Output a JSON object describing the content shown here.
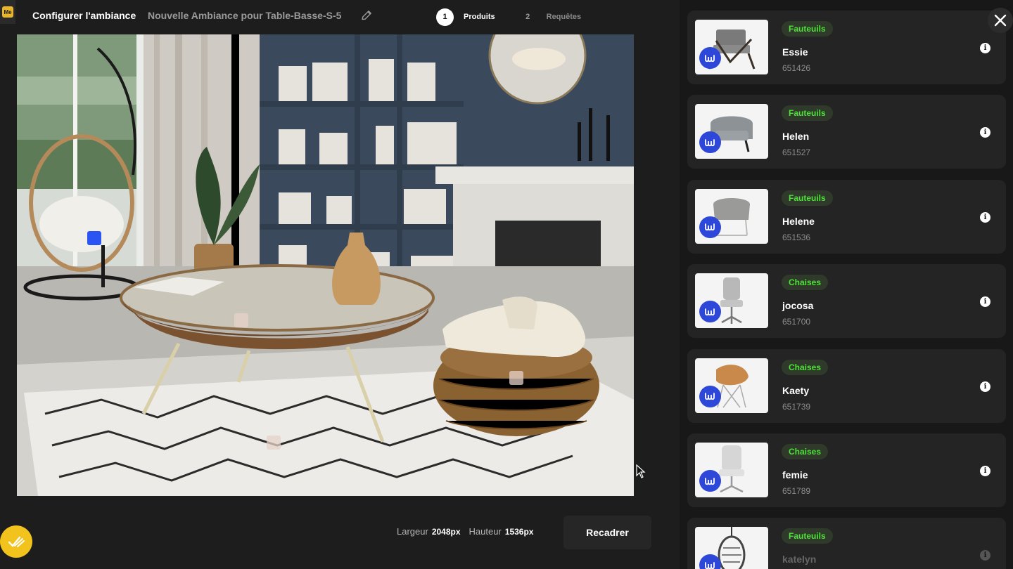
{
  "header": {
    "title": "Configurer l'ambiance",
    "subtitle": "Nouvelle Ambiance pour Table-Basse-S-5",
    "logo_text": "Me"
  },
  "stepper": {
    "steps": [
      {
        "number": "1",
        "label": "Produits",
        "active": true
      },
      {
        "number": "2",
        "label": "Requêtes",
        "active": false
      }
    ]
  },
  "footer": {
    "width_label": "Largeur",
    "width_value": "2048px",
    "height_label": "Hauteur",
    "height_value": "1536px",
    "recrop_label": "Recadrer"
  },
  "products": [
    {
      "category": "Fauteuils",
      "name": "Essie",
      "ref": "651426",
      "thumb": "armchair-wood"
    },
    {
      "category": "Fauteuils",
      "name": "Helen",
      "ref": "651527",
      "thumb": "armchair-grey"
    },
    {
      "category": "Fauteuils",
      "name": "Helene",
      "ref": "651536",
      "thumb": "armchair-wire"
    },
    {
      "category": "Chaises",
      "name": "jocosa",
      "ref": "651700",
      "thumb": "office-chair"
    },
    {
      "category": "Chaises",
      "name": "Kaety",
      "ref": "651739",
      "thumb": "shell-chair"
    },
    {
      "category": "Chaises",
      "name": "femie",
      "ref": "651789",
      "thumb": "office-chair-white"
    },
    {
      "category": "Fauteuils",
      "name": "katelyn",
      "ref": "",
      "thumb": "hanging-chair"
    }
  ],
  "colors": {
    "accent_blue": "#2b55f2",
    "category_green": "#4ee23a",
    "badge_yellow": "#f2c31c"
  }
}
